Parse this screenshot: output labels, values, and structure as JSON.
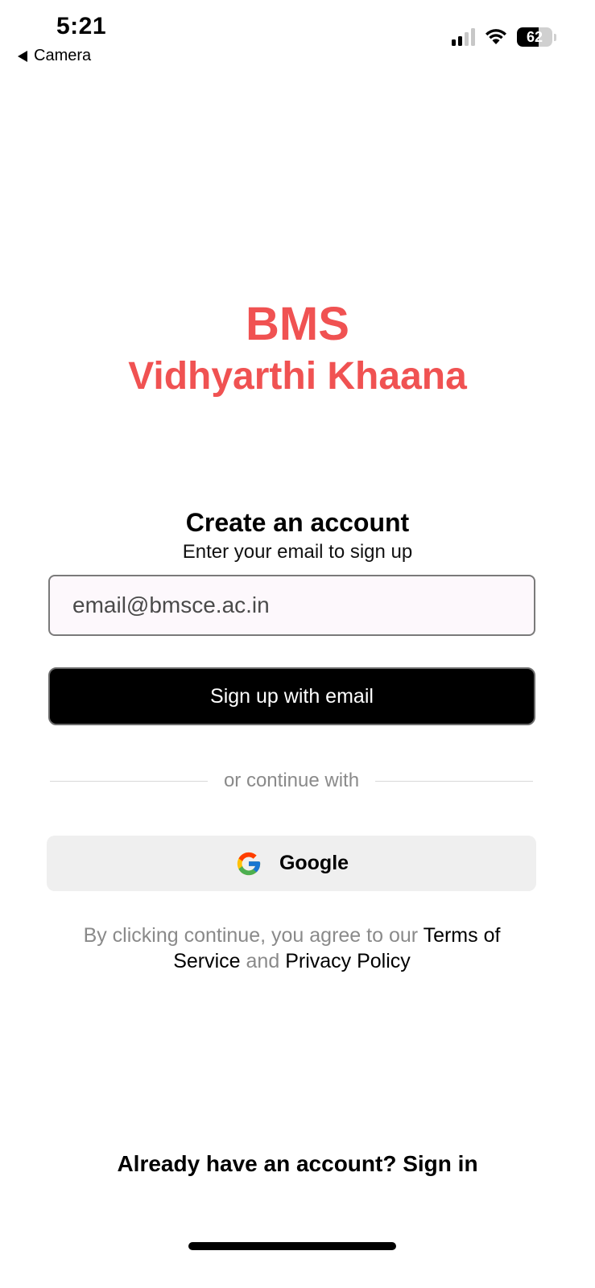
{
  "status_bar": {
    "time": "5:21",
    "back_label": "Camera",
    "battery_percent": "62",
    "battery_level": 0.62,
    "signal_bars_active": 2,
    "signal_bars_total": 4
  },
  "brand": {
    "line1": "BMS",
    "line2": "Vidhyarthi Khaana",
    "color": "#f05252"
  },
  "signup": {
    "title": "Create an account",
    "subtitle": "Enter your email to sign up",
    "email_placeholder": "email@bmsce.ac.in",
    "email_value": "",
    "submit_label": "Sign up with email"
  },
  "divider": {
    "label": "or continue with"
  },
  "google": {
    "label": "Google",
    "icon": "google-icon"
  },
  "legal": {
    "prefix": "By clicking continue, you agree to our",
    "terms_link": "Terms of Service",
    "conjunction": "and",
    "privacy_link": "Privacy Policy"
  },
  "footer": {
    "signin_text": "Already have an account? Sign in"
  }
}
